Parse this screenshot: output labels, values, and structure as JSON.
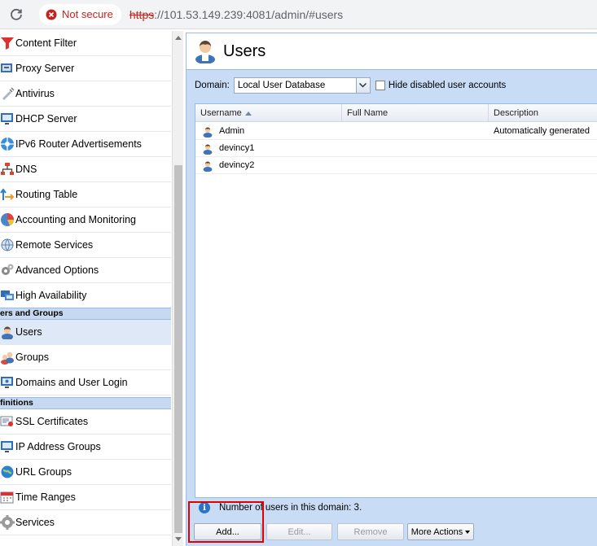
{
  "browser": {
    "security_label": "Not secure",
    "url_scheme": "https",
    "url_rest": "://101.53.149.239:4081/admin/#users"
  },
  "sidebar": {
    "items_top": [
      {
        "label": "Content Filter",
        "icon": "funnel-icon"
      },
      {
        "label": "Proxy Server",
        "icon": "proxy-icon"
      },
      {
        "label": "Antivirus",
        "icon": "syringe-icon"
      },
      {
        "label": "DHCP Server",
        "icon": "monitor-icon"
      },
      {
        "label": "IPv6 Router Advertisements",
        "icon": "network-hub-icon"
      },
      {
        "label": "DNS",
        "icon": "dns-tree-icon"
      },
      {
        "label": "Routing Table",
        "icon": "routing-arrows-icon"
      },
      {
        "label": "Accounting and Monitoring",
        "icon": "pie-chart-icon"
      },
      {
        "label": "Remote Services",
        "icon": "remote-globe-icon"
      },
      {
        "label": "Advanced Options",
        "icon": "gears-icon"
      },
      {
        "label": "High Availability",
        "icon": "servers-icon"
      }
    ],
    "section_users": "ers and Groups",
    "items_users": [
      {
        "label": "Users",
        "icon": "user-icon",
        "selected": true
      },
      {
        "label": "Groups",
        "icon": "group-icon"
      },
      {
        "label": "Domains and User Login",
        "icon": "domain-login-icon"
      }
    ],
    "section_definitions": "finitions",
    "items_definitions": [
      {
        "label": "SSL Certificates",
        "icon": "certificate-icon"
      },
      {
        "label": "IP Address Groups",
        "icon": "ip-group-icon"
      },
      {
        "label": "URL Groups",
        "icon": "url-globe-icon"
      },
      {
        "label": "Time Ranges",
        "icon": "calendar-icon"
      },
      {
        "label": "Services",
        "icon": "services-gear-icon"
      }
    ]
  },
  "main": {
    "title": "Users",
    "domain_label": "Domain:",
    "domain_value": "Local User Database",
    "hide_disabled_label": "Hide disabled user accounts",
    "hide_disabled_checked": false,
    "columns": [
      "Username",
      "Full Name",
      "Description"
    ],
    "sort_column": "Username",
    "rows": [
      {
        "username": "Admin",
        "full_name": "",
        "description": "Automatically generated"
      },
      {
        "username": "devincy1",
        "full_name": "",
        "description": ""
      },
      {
        "username": "devincy2",
        "full_name": "",
        "description": ""
      }
    ],
    "info_text": "Number of users in this domain: 3.",
    "buttons": {
      "add": "Add...",
      "edit": "Edit...",
      "remove": "Remove",
      "more": "More Actions"
    }
  },
  "colors": {
    "accent": "#99bbe8",
    "selected_row": "#dfe8f6",
    "panel_bg": "#c9dcf5",
    "highlight": "#e00000"
  }
}
